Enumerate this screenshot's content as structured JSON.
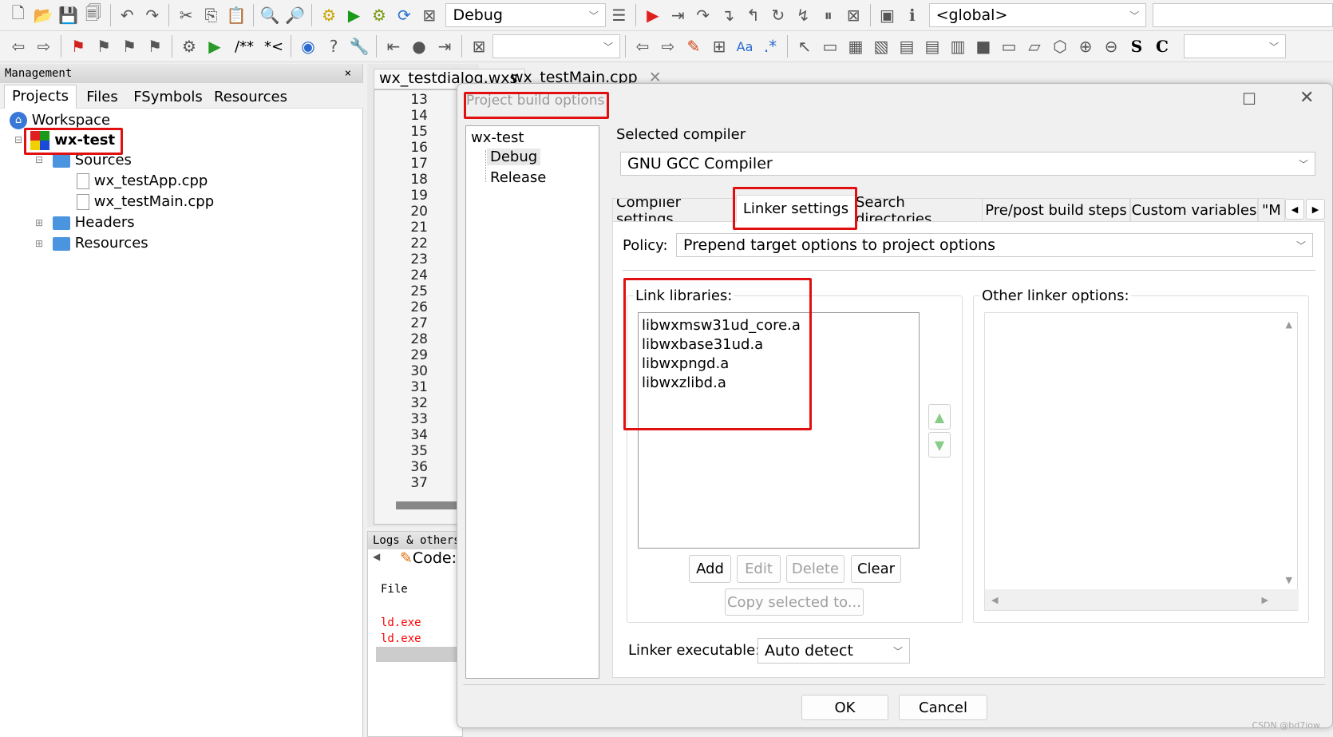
{
  "toolbar1": {
    "icons": [
      "new-file-icon",
      "open-icon",
      "save-icon",
      "save-all-icon",
      "undo-icon",
      "redo-icon",
      "cut-icon",
      "copy-icon",
      "paste-icon",
      "find-icon",
      "replace-icon",
      "build-icon",
      "run-icon",
      "build-run-icon",
      "rebuild-icon",
      "abort-icon"
    ],
    "build_target": "Debug",
    "debug_icons": [
      "debug-run-icon",
      "run-to-cursor-icon",
      "next-line-icon",
      "step-into-icon",
      "step-out-icon",
      "next-instruction-icon",
      "step-into-instruction-icon",
      "pause-icon",
      "stop-icon"
    ],
    "scope": "<global>"
  },
  "toolbar2": {
    "icons": [
      "back-icon",
      "forward-icon",
      "bookmark-icon",
      "prev-bookmark-icon",
      "next-bookmark-icon",
      "clear-bookmarks-icon"
    ],
    "doc_comment": "/**",
    "comment": "*<"
  },
  "management": {
    "title": "Management",
    "close": "×",
    "tabs": [
      "Projects",
      "Files",
      "FSymbols",
      "Resources"
    ],
    "tree": {
      "workspace": "Workspace",
      "project": "wx-test",
      "sources": "Sources",
      "files": [
        "wx_testApp.cpp",
        "wx_testMain.cpp"
      ],
      "headers": "Headers",
      "resources": "Resources"
    }
  },
  "editor": {
    "tabs": [
      "wx_testdialog.wxs",
      "wx_testMain.cpp"
    ],
    "close": "✕",
    "line_numbers": [
      "13",
      "14",
      "15",
      "16",
      "17",
      "18",
      "19",
      "20",
      "21",
      "22",
      "23",
      "24",
      "25",
      "26",
      "27",
      "28",
      "29",
      "30",
      "31",
      "32",
      "33",
      "34",
      "35",
      "36",
      "37"
    ]
  },
  "logs": {
    "title": "Logs & others",
    "tab": "Code:",
    "column": "File",
    "rows": [
      "ld.exe",
      "ld.exe"
    ]
  },
  "dialog": {
    "title": "Project build options",
    "targets": {
      "project": "wx-test",
      "items": [
        "Debug",
        "Release"
      ],
      "selected": "Debug"
    },
    "selected_compiler_label": "Selected compiler",
    "compiler": "GNU GCC Compiler",
    "tabs": [
      "Compiler settings",
      "Linker settings",
      "Search directories",
      "Pre/post build steps",
      "Custom variables",
      "\"M"
    ],
    "active_tab": "Linker settings",
    "policy_label": "Policy:",
    "policy": "Prepend target options to project options",
    "link_libraries_label": "Link libraries:",
    "link_libraries": [
      "libwxmsw31ud_core.a",
      "libwxbase31ud.a",
      "libwxpngd.a",
      "libwxzlibd.a"
    ],
    "buttons": {
      "add": "Add",
      "edit": "Edit",
      "delete": "Delete",
      "clear": "Clear",
      "copy": "Copy selected to..."
    },
    "other_options_label": "Other linker options:",
    "linker_exe_label": "Linker executable:",
    "linker_exe": "Auto detect",
    "ok": "OK",
    "cancel": "Cancel"
  },
  "watermark": "CSDN @bd7iow",
  "colors": {
    "highlight": "#e01010",
    "log_error": "#ff0000"
  }
}
